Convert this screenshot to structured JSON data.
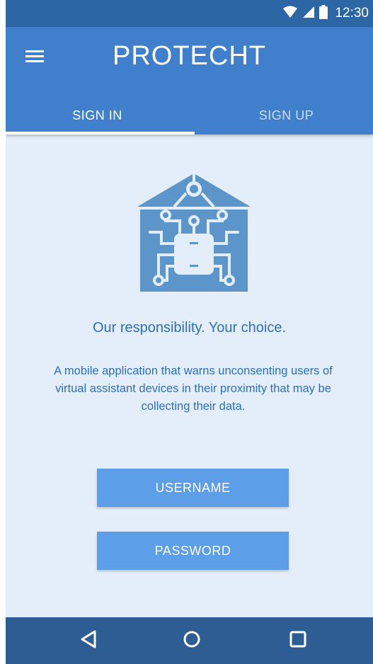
{
  "status_bar": {
    "time": "12:30",
    "icons": [
      "wifi-icon",
      "signal-icon",
      "battery-icon"
    ],
    "color": "#2d66a4"
  },
  "app_bar": {
    "title": "PROTECHT",
    "menu_icon": "menu-icon",
    "color": "#3f7fcb"
  },
  "tabs": [
    {
      "label": "SIGN IN",
      "selected": true
    },
    {
      "label": "SIGN UP",
      "selected": false
    }
  ],
  "main": {
    "logo_icon": "house-circuit-logo-icon",
    "tagline": "Our responsibility. Your choice.",
    "description": "A mobile application that warns unconsenting users of virtual assistant devices in their proximity that may be collecting their data.",
    "background": "#e4eefa",
    "accent": "#2d6fb8"
  },
  "form": {
    "username_label": "USERNAME",
    "password_label": "PASSWORD",
    "field_color": "#5c9ee8"
  },
  "nav_bar": {
    "buttons": [
      "back-icon",
      "home-icon",
      "recent-apps-icon"
    ],
    "color": "#2d5d93"
  }
}
